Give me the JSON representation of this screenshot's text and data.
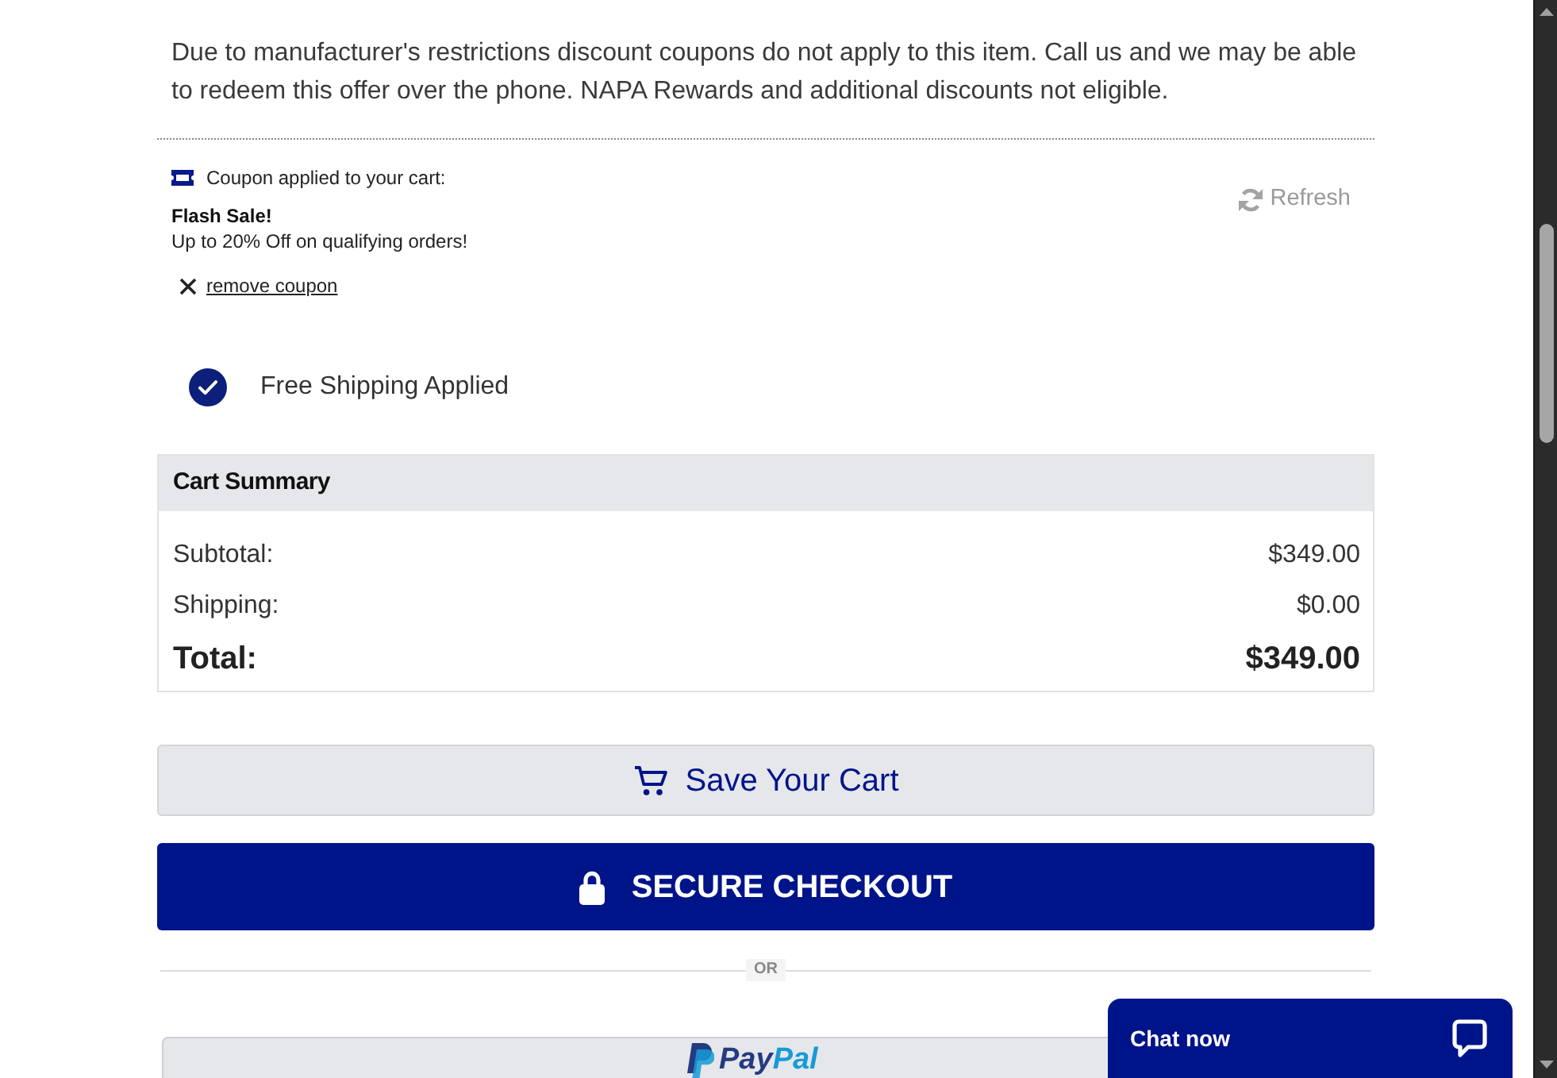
{
  "notice": {
    "text": "Due to manufacturer's restrictions discount coupons do not apply to this item. Call us and we may be able to redeem this offer over the phone. NAPA Rewards and additional discounts not eligible."
  },
  "coupon": {
    "heading": "Coupon applied to your cart:",
    "name": "Flash Sale!",
    "description": "Up to 20% Off on qualifying orders!",
    "remove_link": "remove coupon",
    "refresh_button": "Refresh"
  },
  "shipping_notice": {
    "text": "Free Shipping Applied"
  },
  "cart_summary": {
    "title": "Cart Summary",
    "rows": [
      {
        "kind": "line",
        "label": "Subtotal:",
        "value": "$349.00"
      },
      {
        "kind": "line",
        "label": "Shipping:",
        "value": "$0.00"
      },
      {
        "kind": "total",
        "label": "Total:",
        "value": "$349.00"
      }
    ]
  },
  "buttons": [
    {
      "kind": "save",
      "label": "Save Your Cart"
    },
    {
      "kind": "checkout",
      "label": "SECURE CHECKOUT"
    }
  ],
  "divider": {
    "label": "OR"
  },
  "paypal_button": {
    "wordmark": [
      "Pay",
      "Pal"
    ]
  },
  "chat_widget": {
    "label": "Chat now"
  }
}
